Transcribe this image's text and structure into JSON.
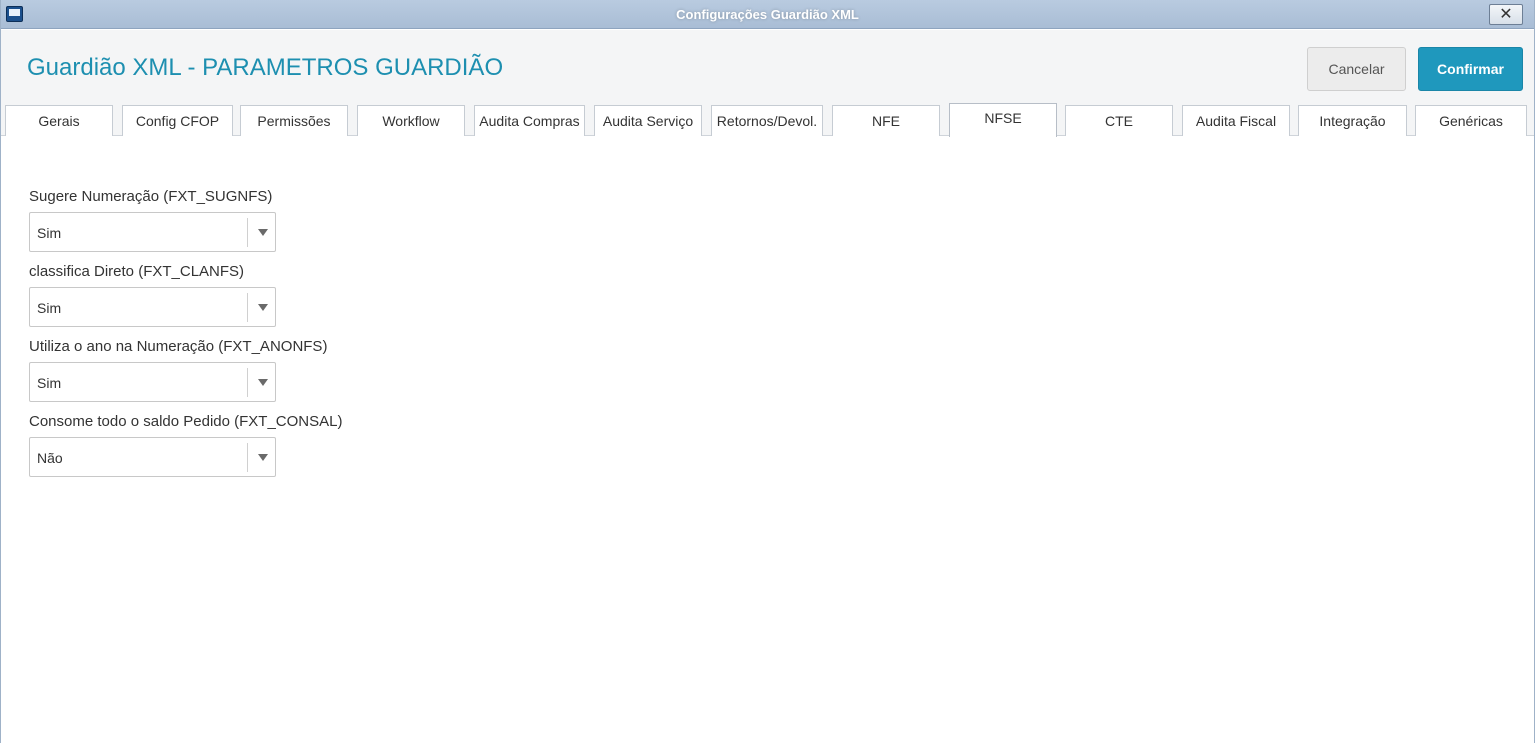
{
  "window": {
    "title": "Configurações Guardião XML",
    "close_glyph": "✕"
  },
  "header": {
    "title": "Guardião XML - PARAMETROS GUARDIÃO",
    "cancel_label": "Cancelar",
    "confirm_label": "Confirmar"
  },
  "tabs": [
    {
      "label": "Gerais"
    },
    {
      "label": "Config CFOP"
    },
    {
      "label": "Permissões"
    },
    {
      "label": "Workflow"
    },
    {
      "label": "Audita Compras"
    },
    {
      "label": "Audita Serviço"
    },
    {
      "label": "Retornos/Devol."
    },
    {
      "label": "NFE"
    },
    {
      "label": "NFSE",
      "active": true
    },
    {
      "label": "CTE"
    },
    {
      "label": "Audita Fiscal"
    },
    {
      "label": "Integração"
    },
    {
      "label": "Genéricas"
    }
  ],
  "fields": [
    {
      "label": "Sugere Numeração (FXT_SUGNFS)",
      "value": "Sim"
    },
    {
      "label": "classifica Direto (FXT_CLANFS)",
      "value": "Sim"
    },
    {
      "label": "Utiliza o ano na Numeração (FXT_ANONFS)",
      "value": "Sim"
    },
    {
      "label": "Consome todo o saldo Pedido (FXT_CONSAL)",
      "value": "Não"
    }
  ],
  "colors": {
    "accent": "#1f98bd",
    "title_text": "#1d8fb0",
    "titlebar": "#b0c4db"
  }
}
